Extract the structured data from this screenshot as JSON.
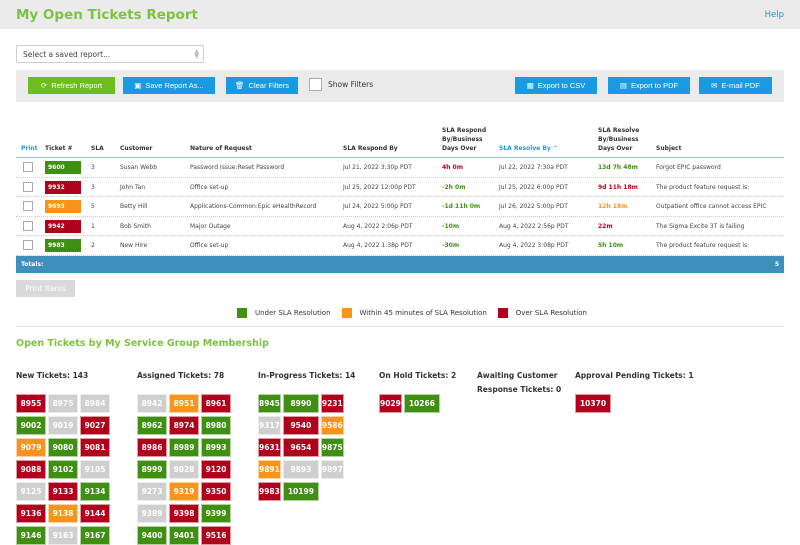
{
  "header": {
    "title": "My Open Tickets Report",
    "help": "Help"
  },
  "saved_report": {
    "placeholder": "Select a saved report..."
  },
  "toolbar": {
    "refresh": "Refresh Report",
    "save_as": "Save Report As...",
    "clear_filters": "Clear Filters",
    "show_filters": "Show Filters",
    "export_csv": "Export to CSV",
    "export_pdf": "Export to PDF",
    "email_pdf": "E-mail PDF"
  },
  "colors": {
    "green": "#3f8f12",
    "red": "#b0001b",
    "orange": "#f7941d",
    "gray": "#cfcfcf",
    "brand_green": "#7cc243",
    "blue": "#1a9ae0",
    "totals_blue": "#3f8fbc"
  },
  "table": {
    "headers": {
      "print": "Print",
      "ticket": "Ticket #",
      "sla": "SLA",
      "customer": "Customer",
      "nature": "Nature of Request",
      "respond_by": "SLA Respond By",
      "respond_over": "SLA Respond By/Business Days Over",
      "resolve_by": "SLA Resolve By ⌃",
      "resolve_over": "SLA Resolve By/Business Days Over",
      "subject": "Subject"
    },
    "rows": [
      {
        "ticket": "9600",
        "status": "green",
        "sla": "3",
        "customer": "Susan Webb",
        "nature": "Password Issue:Reset Password",
        "respond_by": "Jul 21, 2022 3:30p PDT",
        "respond_over": "4h 0m",
        "respond_status": "red",
        "resolve_by": "Jul 22, 2022 7:30a PDT",
        "resolve_over": "13d 7h 48m",
        "resolve_status": "green",
        "subject": "Forgot EPIC password"
      },
      {
        "ticket": "9932",
        "status": "red",
        "sla": "3",
        "customer": "John Tan",
        "nature": "Office set-up",
        "respond_by": "Jul 25, 2022 12:00p PDT",
        "respond_over": "-2h 0m",
        "respond_status": "green",
        "resolve_by": "Jul 25, 2022 6:00p PDT",
        "resolve_over": "9d 11h 18m",
        "resolve_status": "red",
        "subject": "The product feature request is:"
      },
      {
        "ticket": "9693",
        "status": "orange",
        "sla": "5",
        "customer": "Betty Hill",
        "nature": "Applications-Common:Epic eHealthRecord",
        "respond_by": "Jul 24, 2022 5:00p PDT",
        "respond_over": "-1d 11h 0m",
        "respond_status": "green",
        "resolve_by": "Jul 26, 2022 5:00p PDT",
        "resolve_over": "12h 18m",
        "resolve_status": "orange",
        "subject": "Outpatient office cannot access EPIC"
      },
      {
        "ticket": "9942",
        "status": "red",
        "sla": "1",
        "customer": "Bob Smith",
        "nature": "Major Outage",
        "respond_by": "Aug 4, 2022 2:06p PDT",
        "respond_over": "-10m",
        "respond_status": "green",
        "resolve_by": "Aug 4, 2022 2:56p PDT",
        "resolve_over": "22m",
        "resolve_status": "red",
        "subject": "The Sigma Excite 3T is failing"
      },
      {
        "ticket": "9983",
        "status": "green",
        "sla": "2",
        "customer": "New Hire",
        "nature": "Office set-up",
        "respond_by": "Aug 4, 2022 1:38p PDT",
        "respond_over": "-30m",
        "respond_status": "green",
        "resolve_by": "Aug 4, 2022 3:08p PDT",
        "resolve_over": "5h 10m",
        "resolve_status": "green",
        "subject": "The product feature request is:"
      }
    ],
    "totals_label": "Totals:",
    "totals_value": "5"
  },
  "print_items": "Print Items",
  "legend": [
    {
      "label": "Under SLA Resolution",
      "color": "green"
    },
    {
      "label": "Within 45 minutes of SLA Resolution",
      "color": "orange"
    },
    {
      "label": "Over SLA Resolution",
      "color": "red"
    }
  ],
  "groups_title": "Open Tickets by My Service Group Membership",
  "groups": [
    {
      "title": "New Tickets: 143",
      "tickets": [
        [
          "8955",
          "red"
        ],
        [
          "8975",
          "gray"
        ],
        [
          "8984",
          "gray"
        ],
        [
          "9002",
          "green"
        ],
        [
          "9019",
          "gray"
        ],
        [
          "9027",
          "red"
        ],
        [
          "9079",
          "orange"
        ],
        [
          "9080",
          "green"
        ],
        [
          "9081",
          "red"
        ],
        [
          "9088",
          "red"
        ],
        [
          "9102",
          "green"
        ],
        [
          "9105",
          "gray"
        ],
        [
          "9125",
          "gray"
        ],
        [
          "9133",
          "red"
        ],
        [
          "9134",
          "green"
        ],
        [
          "9136",
          "red"
        ],
        [
          "9138",
          "orange"
        ],
        [
          "9144",
          "red"
        ],
        [
          "9146",
          "green"
        ],
        [
          "9163",
          "gray"
        ],
        [
          "9167",
          "green"
        ]
      ]
    },
    {
      "title": "Assigned Tickets: 78",
      "tickets": [
        [
          "8942",
          "gray"
        ],
        [
          "8951",
          "orange"
        ],
        [
          "8961",
          "red"
        ],
        [
          "8962",
          "green"
        ],
        [
          "8974",
          "red"
        ],
        [
          "8980",
          "green"
        ],
        [
          "8986",
          "red"
        ],
        [
          "8989",
          "green"
        ],
        [
          "8993",
          "green"
        ],
        [
          "8999",
          "green"
        ],
        [
          "9028",
          "gray"
        ],
        [
          "9120",
          "red"
        ],
        [
          "9273",
          "gray"
        ],
        [
          "9319",
          "orange"
        ],
        [
          "9350",
          "red"
        ],
        [
          "9389",
          "gray"
        ],
        [
          "9398",
          "red"
        ],
        [
          "9399",
          "green"
        ],
        [
          "9400",
          "green"
        ],
        [
          "9401",
          "green"
        ],
        [
          "9516",
          "red"
        ]
      ]
    },
    {
      "title": "In-Progress Tickets: 14",
      "tickets": [
        [
          "8945",
          "green"
        ],
        [
          "8990",
          "green"
        ],
        [
          "9231",
          "red"
        ],
        [
          "9317",
          "gray"
        ],
        [
          "9540",
          "red"
        ],
        [
          "9586",
          "orange"
        ],
        [
          "9631",
          "red"
        ],
        [
          "9654",
          "red"
        ],
        [
          "9875",
          "green"
        ],
        [
          "9891",
          "orange"
        ],
        [
          "9893",
          "gray"
        ],
        [
          "9897",
          "gray"
        ],
        [
          "9983",
          "red"
        ],
        [
          "10199",
          "green"
        ]
      ]
    },
    {
      "title": "On Hold Tickets: 2",
      "tickets": [
        [
          "9029",
          "red"
        ],
        [
          "10266",
          "green"
        ]
      ]
    },
    {
      "title": "Awaiting Customer Response Tickets: 0",
      "tickets": []
    },
    {
      "title": "Approval Pending Tickets: 1",
      "tickets": [
        [
          "10370",
          "red"
        ]
      ]
    }
  ]
}
